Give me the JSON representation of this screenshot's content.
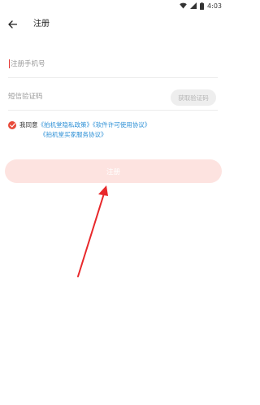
{
  "status_bar": {
    "time": "4:03",
    "icons": [
      "wifi-icon",
      "signal-icon",
      "battery-icon"
    ]
  },
  "header": {
    "back_icon": "arrow-left-icon",
    "title": "注册"
  },
  "form": {
    "phone_placeholder": "注册手机号",
    "phone_value": "",
    "code_placeholder": "短信验证码",
    "code_value": "",
    "get_code_label": "获取验证码"
  },
  "agreement": {
    "checked": true,
    "prefix": "我同意",
    "links": [
      "《拍机堂隐私政策》",
      "《软件许可使用协议》",
      "《拍机堂买家服务协议》"
    ]
  },
  "register_label": "注册",
  "colors": {
    "accent": "#e84a3a",
    "button_disabled_bg": "#fde3e0",
    "link": "#2b8fd6",
    "annotation_arrow": "#e8282b"
  }
}
